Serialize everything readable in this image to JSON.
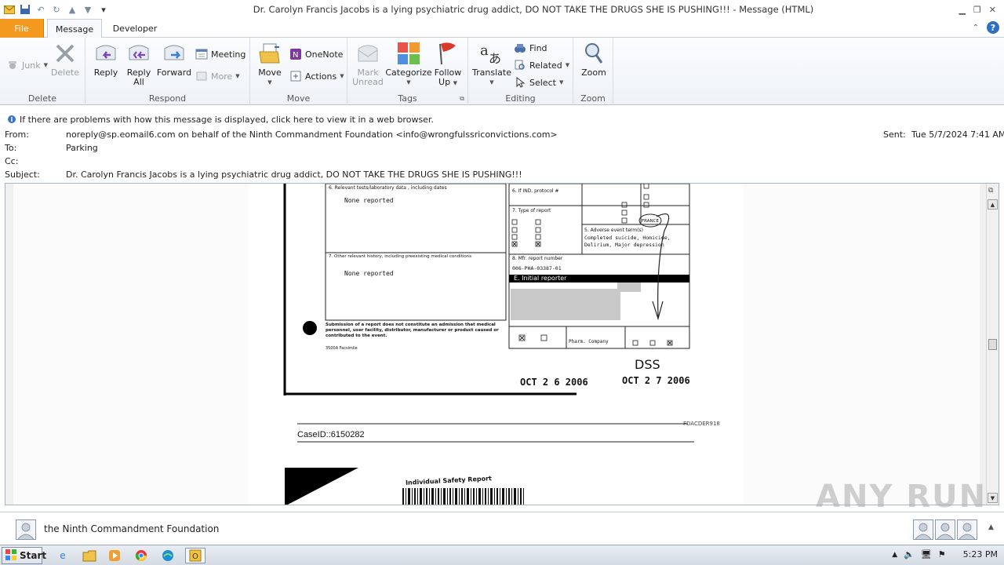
{
  "window": {
    "title": "Dr. Carolyn Francis Jacobs is a lying psychiatric drug addict, DO NOT TAKE THE DRUGS SHE IS PUSHING!!!  -  Message (HTML)"
  },
  "tabs": {
    "file": "File",
    "items": [
      "Message",
      "Developer"
    ]
  },
  "ribbon": {
    "delete": {
      "label": "Delete",
      "junk": "Junk",
      "delete": "Delete"
    },
    "respond": {
      "label": "Respond",
      "reply": "Reply",
      "reply_all_1": "Reply",
      "reply_all_2": "All",
      "forward": "Forward",
      "meeting": "Meeting",
      "more": "More"
    },
    "move": {
      "label": "Move",
      "move": "Move",
      "onenote": "OneNote",
      "actions": "Actions"
    },
    "tags": {
      "label": "Tags",
      "mark_unread_1": "Mark",
      "mark_unread_2": "Unread",
      "categorize": "Categorize",
      "follow_up_1": "Follow",
      "follow_up_2": "Up"
    },
    "editing": {
      "label": "Editing",
      "translate": "Translate",
      "find": "Find",
      "related": "Related",
      "select": "Select"
    },
    "zoom": {
      "label": "Zoom",
      "zoom": "Zoom"
    }
  },
  "message": {
    "info_bar": "If there are problems with how this message is displayed, click here to view it in a web browser.",
    "from_label": "From:",
    "from": "noreply@sp.eomail6.com on behalf of the Ninth Commandment Foundation <info@wrongfulssriconvictions.com>",
    "to_label": "To:",
    "to": "Parking",
    "cc_label": "Cc:",
    "cc": "",
    "subject_label": "Subject:",
    "subject": "Dr. Carolyn Francis Jacobs is a lying psychiatric drug addict, DO NOT TAKE THE DRUGS SHE IS PUSHING!!!",
    "sent_label": "Sent:",
    "sent": "Tue 5/7/2024 7:41 AM"
  },
  "scan": {
    "none_reported_1": "None reported",
    "none_reported_2": "None reported",
    "history_label": "7. Other relevant history, including preexisting medical conditions",
    "lab_label": "6. Relevant tests/laboratory data , including dates",
    "ind_label": "6. If IND, protocol #",
    "type_label": "7. Type of report",
    "mfr_label": "8. Mfr. report number",
    "mfr_number": "006-PHA-03387-01",
    "adverse_label": "5. Adverse event term(s)",
    "adverse_text": "Completed suicide, Homicide, Delirium, Major depression",
    "france": "FRANCE",
    "initial_reporter": "E.   Initial reporter",
    "occupation": "Pharm. Company",
    "submission": "Submission of a report does not constitute an admission that medical personnel, user facility, distributor, manufacturer or product caused or contributed to the event.",
    "facsimile": "3500A Facsimile",
    "dss": "DSS",
    "date1": "OCT 2 6 2006",
    "date2": "OCT 2 7 2006",
    "fdacder": "FDACDER918",
    "caseid": "CaseID::6150282",
    "isr": "Individual Safety Report"
  },
  "people": {
    "name": "the Ninth Commandment Foundation"
  },
  "taskbar": {
    "start": "Start",
    "time": "5:23 PM"
  },
  "watermark": "ANY RUN"
}
